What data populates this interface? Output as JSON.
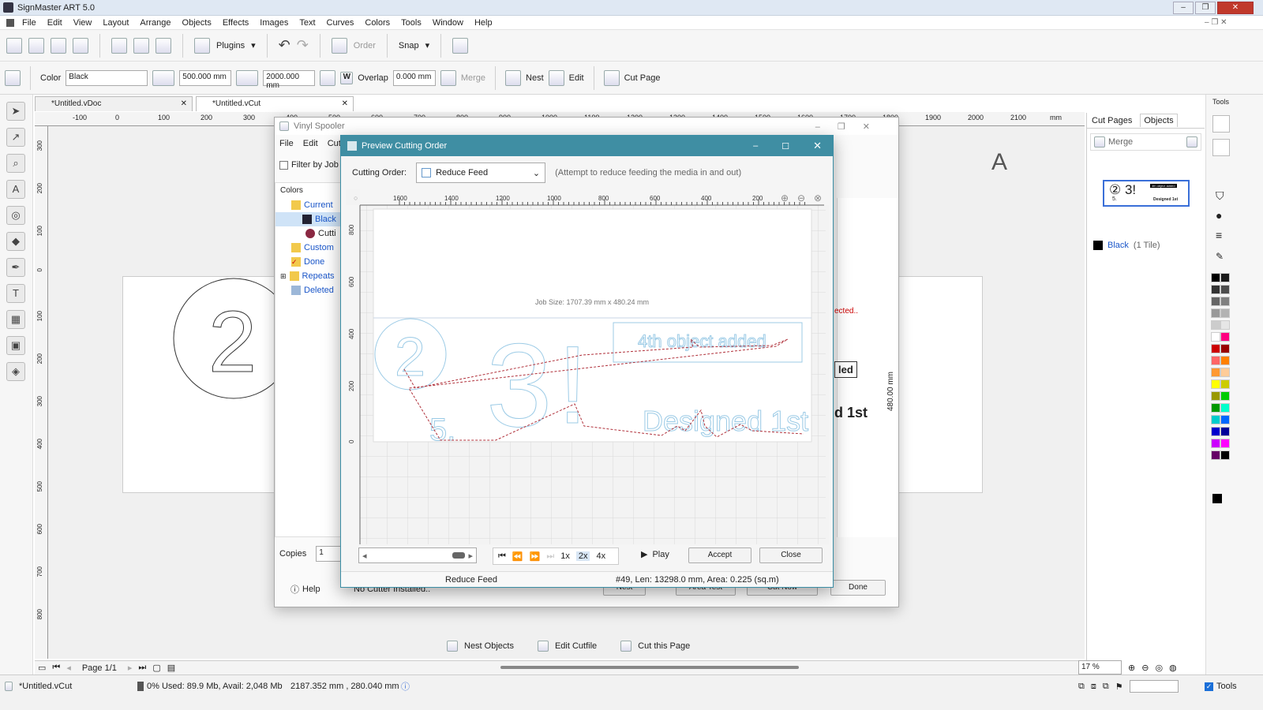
{
  "app": {
    "title": "SignMaster ART 5.0"
  },
  "menu": [
    "File",
    "Edit",
    "View",
    "Layout",
    "Arrange",
    "Objects",
    "Effects",
    "Images",
    "Text",
    "Curves",
    "Colors",
    "Tools",
    "Window",
    "Help"
  ],
  "toolbar1": {
    "plugins_label": "Plugins",
    "order_label": "Order",
    "snap_label": "Snap"
  },
  "toolbar2": {
    "color_label": "Color",
    "color_value": "Black",
    "width_value": "500.000 mm",
    "length_value": "2000.000 mm",
    "overlap_label": "Overlap",
    "overlap_value": "0.000 mm",
    "w_label": "W",
    "merge_label": "Merge",
    "nest_label": "Nest",
    "edit_label": "Edit",
    "cutpage_label": "Cut Page"
  },
  "doc_tabs": [
    {
      "label": "*Untitled.vDoc"
    },
    {
      "label": "*Untitled.vCut"
    }
  ],
  "hruler_ticks": [
    "-100",
    "0",
    "100",
    "200",
    "300",
    "400",
    "500",
    "600",
    "700",
    "800",
    "900",
    "1000",
    "1100",
    "1200",
    "1300",
    "1400",
    "1500",
    "1600",
    "1700",
    "1800",
    "1900",
    "2000",
    "2100",
    "mm"
  ],
  "vruler_ticks": [
    "300",
    "200",
    "100",
    "0",
    "100",
    "200",
    "300",
    "400",
    "500",
    "600",
    "700",
    "800"
  ],
  "right_panel": {
    "tab_cut_pages": "Cut Pages",
    "tab_objects": "Objects",
    "merge_label": "Merge",
    "color_name": "Black",
    "tile_count": "(1 Tile)",
    "tools_label": "Tools",
    "thumb_text": "② 3!",
    "thumb_small": "4th object added",
    "thumb_small2": "Designed 1st",
    "thumb_digit": "5."
  },
  "spooler": {
    "title": "Vinyl Spooler",
    "menu": [
      "File",
      "Edit",
      "Cutt"
    ],
    "filter_label": "Filter by Job",
    "colors_label": "Colors",
    "tree": [
      {
        "label": "Current"
      },
      {
        "label": "Black"
      },
      {
        "label": "Cutti"
      },
      {
        "label": "Custom"
      },
      {
        "label": "Done"
      },
      {
        "label": "Repeats"
      },
      {
        "label": "Deleted"
      }
    ],
    "copies_label": "Copies",
    "copies_value": "1",
    "help_label": "Help",
    "no_cutter": "No Cutter Installed..",
    "btn_nest": "Nest",
    "btn_area_test": "Area Test",
    "btn_cut_now": "Cut Now",
    "btn_done": "Done",
    "selected_text": "ected..",
    "behind_label1": "led",
    "behind_label2": "d 1st",
    "dim_label": "480.00 mm",
    "tools_text": "A"
  },
  "preview": {
    "title": "Preview Cutting Order",
    "cutting_order_label": "Cutting Order:",
    "cutting_order_value": "Reduce Feed",
    "hint": "(Attempt to reduce feeding the media in and out)",
    "ruler_x": [
      "1600",
      "1400",
      "1200",
      "1000",
      "800",
      "600",
      "400",
      "200"
    ],
    "ruler_y": [
      "800",
      "600",
      "400",
      "200",
      "0"
    ],
    "job_size": "Job Size: 1707.39 mm x 480.24 mm",
    "art_texts": {
      "digit2": "2",
      "digit3": "3",
      "excl": "!",
      "five": "5.",
      "fourth": "4th object added",
      "designed": "Designed 1st"
    },
    "speeds": [
      "1x",
      "2x",
      "4x"
    ],
    "play_label": "Play",
    "accept_label": "Accept",
    "close_label": "Close",
    "status_mode": "Reduce Feed",
    "status_info": "#49,  Len: 13298.0 mm,  Area: 0.225 (sq.m)"
  },
  "bottom_tools": {
    "nest": "Nest Objects",
    "edit": "Edit Cutfile",
    "cut": "Cut this Page"
  },
  "page_nav": {
    "label": "Page 1/1"
  },
  "zoom": {
    "value": "17 %"
  },
  "statusbar": {
    "file": "*Untitled.vCut",
    "mem": "0%  Used: 89.9 Mb, Avail: 2,048 Mb",
    "coords": "2187.352 mm , 280.040 mm",
    "tools": "Tools"
  },
  "palette": [
    "#000000",
    "#1a1a1a",
    "#333333",
    "#4d4d4d",
    "#666666",
    "#808080",
    "#999999",
    "#b3b3b3",
    "#cccccc",
    "#e6e6e6",
    "#ffffff",
    "#ff0080",
    "#cc0000",
    "#990000",
    "#ff6666",
    "#ff8000",
    "#ff9933",
    "#ffcc99",
    "#ffff00",
    "#cccc00",
    "#999900",
    "#00cc00",
    "#009900",
    "#00ffcc",
    "#00cccc",
    "#0066ff",
    "#0000cc",
    "#000099",
    "#cc00ff",
    "#ff00ff",
    "#660066",
    "#000000"
  ]
}
